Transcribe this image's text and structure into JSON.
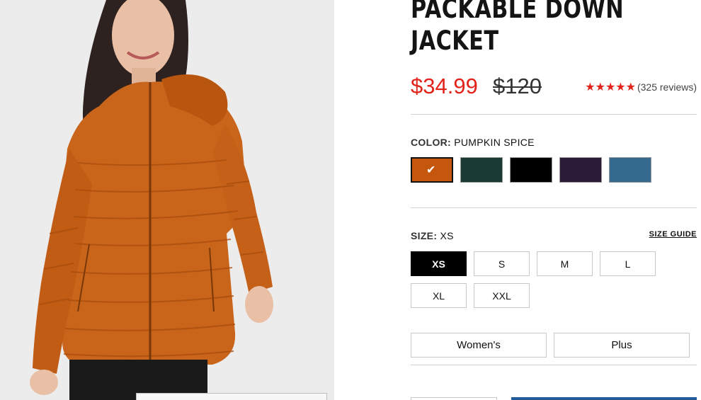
{
  "product": {
    "title_line1": "PACKABLE DOWN",
    "title_line2": "JACKET",
    "sale_price": "$34.99",
    "original_price": "$120",
    "stars": "★★★★★",
    "review_count": "(325 reviews)"
  },
  "color": {
    "label": "COLOR:",
    "selected_name": "PUMPKIN SPICE",
    "check_icon": "check-icon",
    "swatches": [
      {
        "color": "#c4560e"
      },
      {
        "color": "#1a3a35"
      },
      {
        "color": "#000000"
      },
      {
        "color": "#2a1a38"
      },
      {
        "color": "#336a8e"
      }
    ]
  },
  "size": {
    "label": "SIZE:",
    "selected": "XS",
    "guide_link": "SIZE GUIDE",
    "options": [
      "XS",
      "S",
      "M",
      "L",
      "XL",
      "XXL"
    ]
  },
  "fit": {
    "options": [
      "Women's",
      "Plus"
    ]
  },
  "colors": {
    "sale_red": "#e2231a",
    "primary_blue": "#1f5c99",
    "image_background": "#ececec"
  }
}
